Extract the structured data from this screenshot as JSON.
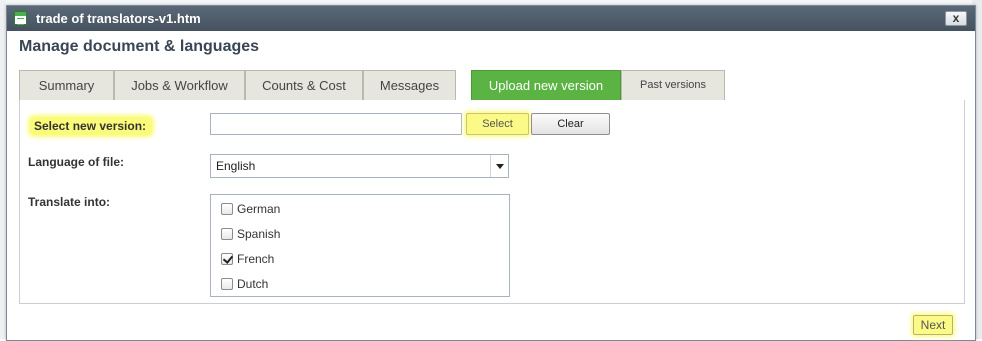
{
  "window": {
    "title": "trade of translators-v1.htm",
    "close_label": "x"
  },
  "dialog": {
    "heading": "Manage document & languages"
  },
  "tabs": [
    {
      "label": "Summary",
      "active": false
    },
    {
      "label": "Jobs & Workflow",
      "active": false
    },
    {
      "label": "Counts & Cost",
      "active": false
    },
    {
      "label": "Messages",
      "active": false
    },
    {
      "label": "Upload new version",
      "active": true
    },
    {
      "label": "Past versions",
      "active": false
    }
  ],
  "form": {
    "select_version_label": "Select new version:",
    "file_value": "",
    "select_button": "Select",
    "clear_button": "Clear",
    "language_label": "Language of file:",
    "language_value": "English",
    "translate_label": "Translate into:",
    "languages": [
      {
        "name": "German",
        "checked": false
      },
      {
        "name": "Spanish",
        "checked": false
      },
      {
        "name": "French",
        "checked": true
      },
      {
        "name": "Dutch",
        "checked": false
      }
    ]
  },
  "footer": {
    "next_button": "Next"
  },
  "colors": {
    "active_tab": "#5ab342",
    "highlight": "#fbfb7a",
    "titlebar": "#4f5b68"
  }
}
